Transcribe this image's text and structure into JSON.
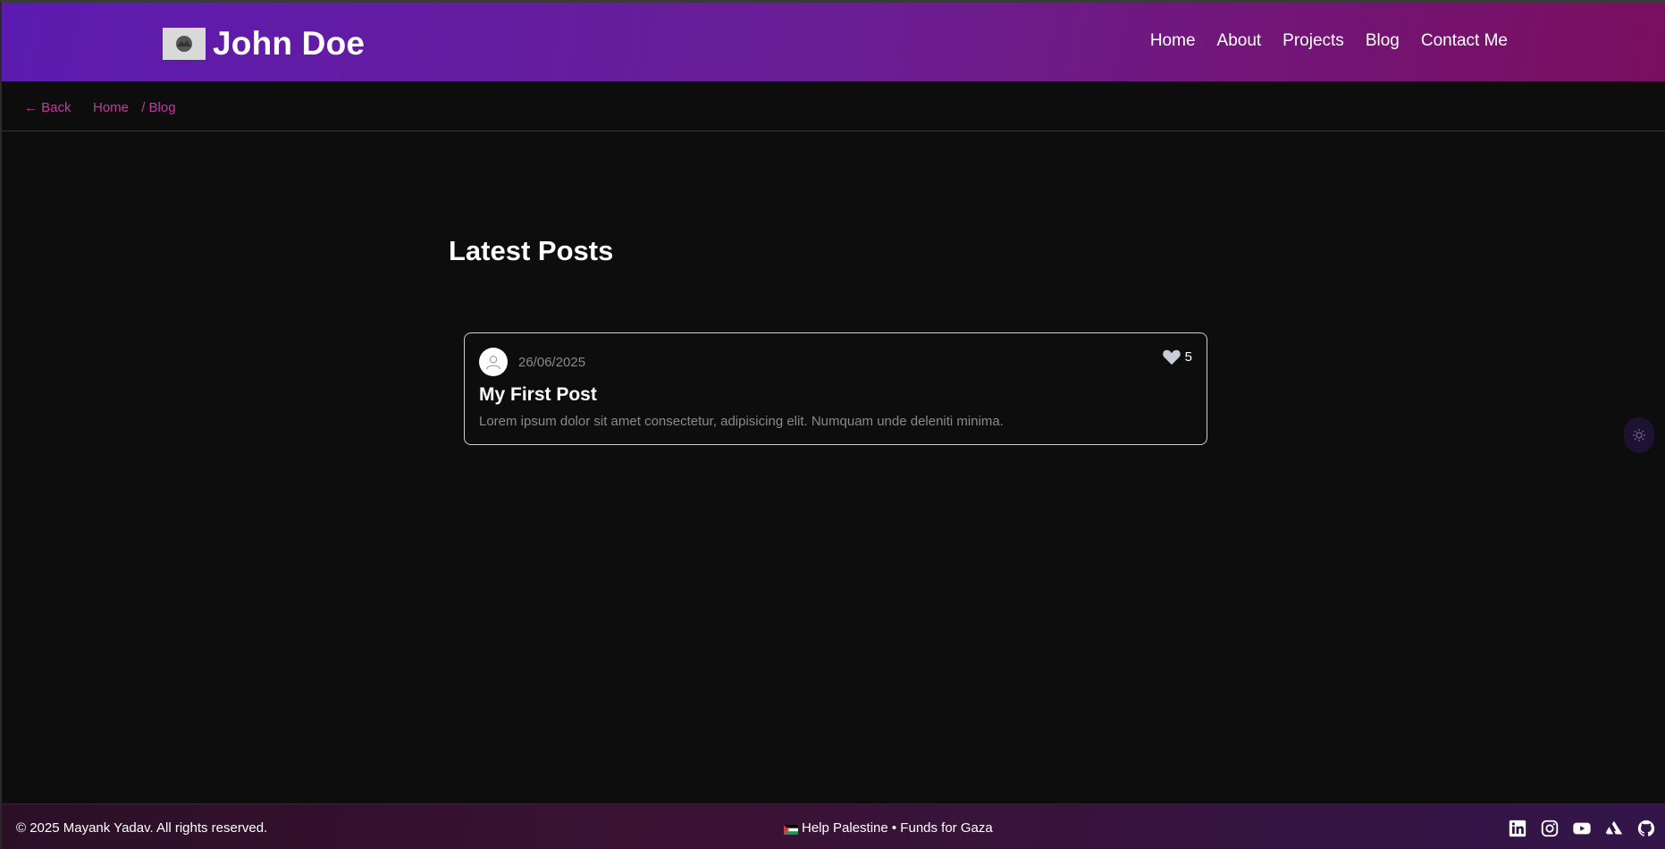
{
  "header": {
    "brand_name": "John Doe",
    "nav": [
      "Home",
      "About",
      "Projects",
      "Blog",
      "Contact Me"
    ]
  },
  "breadcrumb": {
    "back_label": "← Back",
    "home_label": "Home",
    "current_label": "/ Blog"
  },
  "main": {
    "title": "Latest Posts",
    "posts": [
      {
        "date": "26/06/2025",
        "likes": "5",
        "title": "My First Post",
        "excerpt": "Lorem ipsum dolor sit amet consectetur, adipisicing elit. Numquam unde deleniti minima."
      }
    ]
  },
  "footer": {
    "copyright": "© 2025 Mayank Yadav. All rights reserved.",
    "help_text": "Help Palestine • Funds for Gaza",
    "socials": [
      "linkedin-icon",
      "instagram-icon",
      "youtube-icon",
      "artstation-icon",
      "github-icon"
    ]
  },
  "colors": {
    "accent": "#c23aa3",
    "header_start": "#5c1bb0",
    "header_end": "#7a0e5e",
    "background": "#0d0d0d"
  }
}
